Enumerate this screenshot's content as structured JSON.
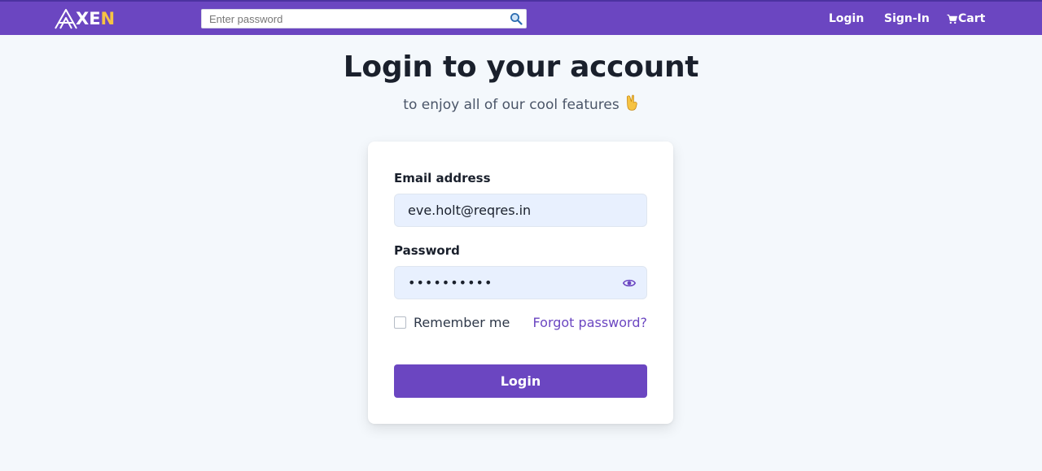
{
  "navbar": {
    "logo_text": "XE",
    "logo_n": "N",
    "search_placeholder": "Enter password",
    "links": {
      "login": "Login",
      "signin": "Sign-In",
      "cart": "Cart"
    },
    "colors": {
      "bar": "#6b46c1",
      "logo_accent": "#f6c343"
    },
    "icons": {
      "search": "search-icon",
      "cart": "cart-icon"
    }
  },
  "page": {
    "title": "Login to your account",
    "subtitle": "to enjoy all of our cool features",
    "subtitle_emoji": "victory-hand-icon"
  },
  "form": {
    "email_label": "Email address",
    "email_value": "eve.holt@reqres.in",
    "password_label": "Password",
    "password_value": "cityslicka",
    "remember_label": "Remember me",
    "remember_checked": false,
    "forgot_label": "Forgot password?",
    "submit_label": "Login",
    "colors": {
      "accent": "#6b46c1",
      "field_bg": "#e8f0fe"
    }
  }
}
